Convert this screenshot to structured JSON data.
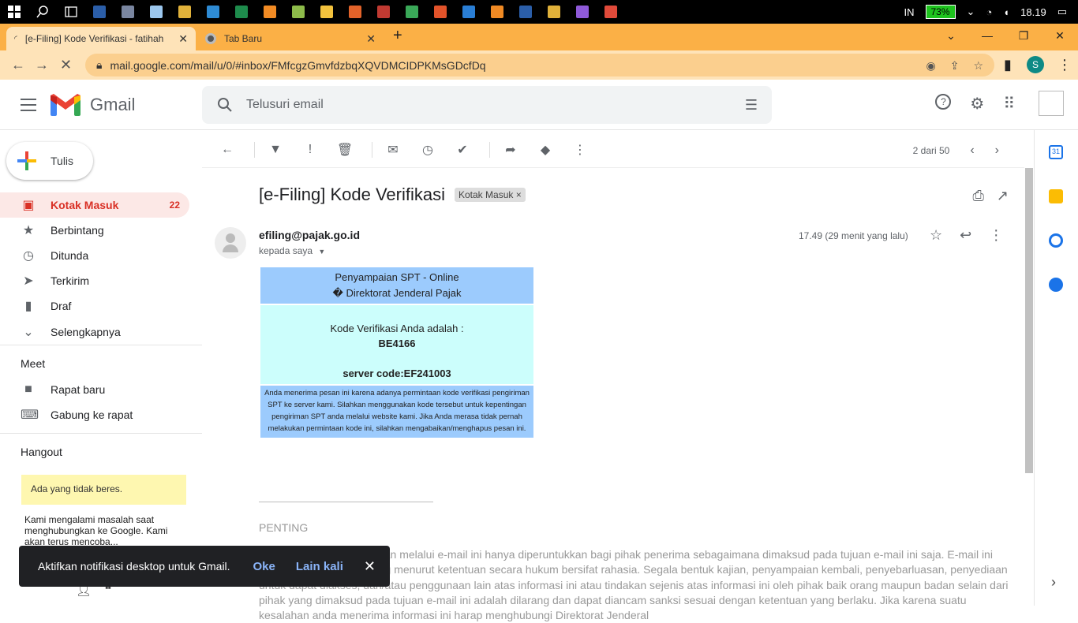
{
  "taskbar": {
    "lang": "IN",
    "battery": "73%",
    "time": "18.19",
    "apps": [
      {
        "name": "ps",
        "color": "#2b5ea8"
      },
      {
        "name": "calc",
        "color": "#7a86a0"
      },
      {
        "name": "notes",
        "color": "#9cc7ee"
      },
      {
        "name": "chrome",
        "color": "#e0b13a"
      },
      {
        "name": "edge",
        "color": "#2e8bd4"
      },
      {
        "name": "excel",
        "color": "#1e8b4c"
      },
      {
        "name": "orange-app",
        "color": "#f28b24"
      },
      {
        "name": "image-app",
        "color": "#8dbb4a"
      },
      {
        "name": "explorer",
        "color": "#f3c23d"
      },
      {
        "name": "converter",
        "color": "#e2632a"
      },
      {
        "name": "tool",
        "color": "#c03a32"
      },
      {
        "name": "photos",
        "color": "#3aa858"
      },
      {
        "name": "pdf",
        "color": "#e2532a"
      },
      {
        "name": "vscode",
        "color": "#2a7ed4"
      },
      {
        "name": "sublime",
        "color": "#f08a24"
      },
      {
        "name": "word",
        "color": "#2b5ea8"
      },
      {
        "name": "chrome2",
        "color": "#e0b13a"
      },
      {
        "name": "browser",
        "color": "#8f5ad8"
      },
      {
        "name": "chrome3",
        "color": "#e04a3a"
      }
    ]
  },
  "tabs": [
    {
      "title": "[e-Filing] Kode Verifikasi - fatihah"
    },
    {
      "title": "Tab Baru"
    }
  ],
  "address": {
    "url": "mail.google.com/mail/u/0/#inbox/FMfcgzGmvfdzbqXQVDMCIDPKMsGDcfDq",
    "profile_initial": "S"
  },
  "gmail": {
    "app_name": "Gmail",
    "search_placeholder": "Telusuri email",
    "compose_label": "Tulis",
    "nav": [
      {
        "label": "Kotak Masuk",
        "count": "22",
        "icon": "inbox-icon"
      },
      {
        "label": "Berbintang",
        "count": "",
        "icon": "star-icon"
      },
      {
        "label": "Ditunda",
        "count": "",
        "icon": "clock-icon"
      },
      {
        "label": "Terkirim",
        "count": "",
        "icon": "send-icon"
      },
      {
        "label": "Draf",
        "count": "",
        "icon": "draft-icon"
      },
      {
        "label": "Selengkapnya",
        "count": "",
        "icon": "chevron-down-icon"
      }
    ],
    "meet": {
      "heading": "Meet",
      "items": [
        {
          "label": "Rapat baru",
          "icon": "video-icon"
        },
        {
          "label": "Gabung ke rapat",
          "icon": "keyboard-icon"
        }
      ]
    },
    "hangout": {
      "heading": "Hangout",
      "warning": "Ada yang tidak beres.",
      "message": "Kami mengalami masalah saat menghubungkan ke Google. Kami akan terus mencoba..."
    },
    "snackbar": {
      "message": "Aktifkan notifikasi desktop untuk Gmail.",
      "ok": "Oke",
      "later": "Lain kali"
    },
    "pager": "2 dari 50"
  },
  "email": {
    "subject": "[e-Filing] Kode Verifikasi",
    "label_chip": "Kotak Masuk",
    "sender": "efiling@pajak.go.id",
    "to": "kepada saya",
    "time": "17.49 (29 menit yang lalu)",
    "box_head_1": "Penyampaian SPT - Online",
    "box_head_2": "� Direktorat Jenderal Pajak",
    "code_intro": "Kode Verifikasi Anda adalah :",
    "code": "BE4166",
    "server_code": "server code:EF241003",
    "note": "Anda menerima pesan ini karena adanya permintaan kode verifikasi pengiriman SPT ke server kami. Silahkan menggunakan kode tersebut untuk kepentingan pengiriman SPT anda melalui website kami. Jika Anda merasa tidak pernah melakukan permintaan kode ini, silahkan mengabaikan/menghapus pesan ini.",
    "penting": "PENTING",
    "disclaimer": "Informasi yang disampaikan melalui e-mail ini hanya diperuntukkan bagi pihak penerima sebagaimana dimaksud pada tujuan e-mail ini saja. E-mail ini dapat berisi informasi yang menurut ketentuan secara hukum bersifat rahasia. Segala bentuk kajian, penyampaian kembali, penyebarluasan, penyediaan untuk dapat diakses, dan/atau penggunaan lain atas informasi ini atau tindakan sejenis atas informasi ini oleh pihak baik orang maupun badan selain dari pihak yang dimaksud pada tujuan e-mail ini adalah dilarang dan dapat diancam sanksi sesuai dengan ketentuan yang berlaku. Jika karena suatu kesalahan anda menerima informasi ini harap menghubungi Direktorat Jenderal"
  }
}
